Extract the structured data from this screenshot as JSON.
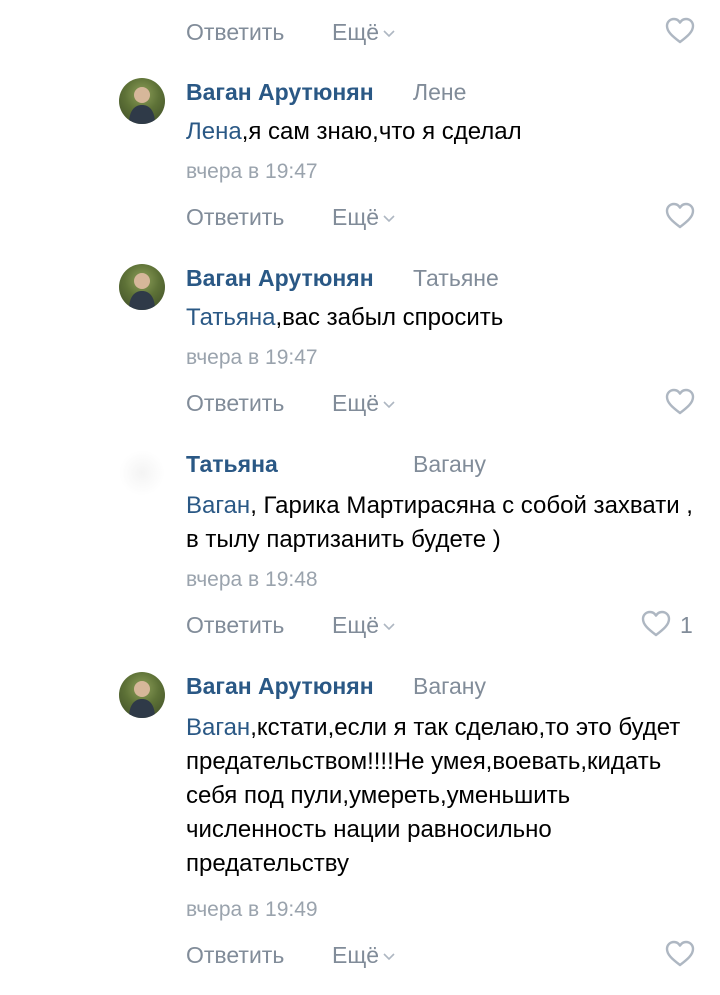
{
  "actions": {
    "reply": "Ответить",
    "more": "Ещё"
  },
  "comments": [
    {
      "author": "",
      "reply_to": "",
      "mention": "",
      "text": "",
      "time": "",
      "likes": ""
    },
    {
      "author": "Ваган Арутюнян",
      "reply_to": "Лене",
      "mention": "Лена",
      "text": ",я сам знаю,что я сделал",
      "time": "вчера в 19:47",
      "likes": ""
    },
    {
      "author": "Ваган Арутюнян",
      "reply_to": "Татьяне",
      "mention": "Татьяна",
      "text": ",вас забыл спросить",
      "time": "вчера в 19:47",
      "likes": ""
    },
    {
      "author": "Татьяна",
      "reply_to": "Вагану",
      "mention": "Ваган",
      "text": ", Гарика Мартирасяна с собой захвати , в тылу партизанить будете )",
      "time": "вчера в 19:48",
      "likes": "1"
    },
    {
      "author": "Ваган Арутюнян",
      "reply_to": "Вагану",
      "mention": "Ваган",
      "text": ",кстати,если я так сделаю,то это будет предательством!!!!Не умея,воевать,кидать себя под пули,умереть,уменьшить численность нации равносильно предательству",
      "time": "вчера в 19:49",
      "likes": ""
    }
  ],
  "icons": {
    "like": "heart-outline-icon",
    "more": "chevron-down-icon",
    "avatar": "avatar"
  },
  "colors": {
    "author": "#2a5885",
    "secondary": "#818c99",
    "text": "#000000",
    "time": "#9aa3ad"
  }
}
